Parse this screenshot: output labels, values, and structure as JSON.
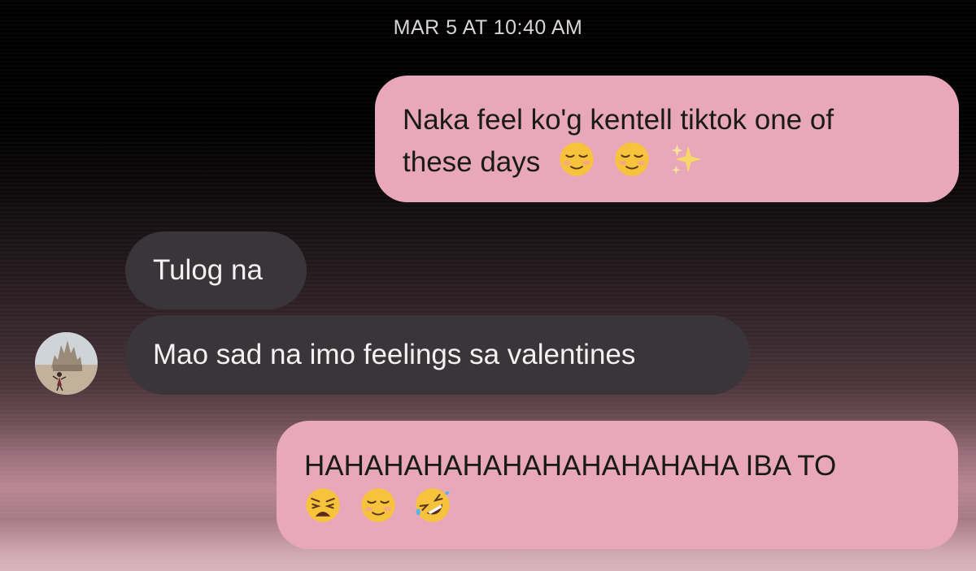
{
  "conversation": {
    "timestamp": "MAR 5 AT 10:40 AM",
    "messages": [
      {
        "direction": "outgoing",
        "lines": [
          "Naka feel ko'g kentell tiktok one of",
          "these days"
        ],
        "emojis": [
          "relieved-face-emoji",
          "relieved-face-emoji",
          "sparkles-emoji"
        ]
      },
      {
        "direction": "incoming",
        "lines": [
          "Tulog na"
        ],
        "emojis": []
      },
      {
        "direction": "incoming",
        "lines": [
          "Mao sad na imo feelings sa valentines"
        ],
        "emojis": []
      },
      {
        "direction": "outgoing",
        "lines": [
          "HAHAHAHAHAHAHAHAHAHAHA IBA TO"
        ],
        "emojis": [
          "weary-face-emoji",
          "relieved-face-emoji",
          "rolling-on-floor-laughing-emoji"
        ]
      }
    ]
  },
  "avatar": {
    "icon": "contact-avatar-photo"
  },
  "colors": {
    "outgoing_bubble": "#e8a8ba",
    "incoming_bubble": "#3a3539",
    "timestamp_text": "#d9d4d6"
  }
}
